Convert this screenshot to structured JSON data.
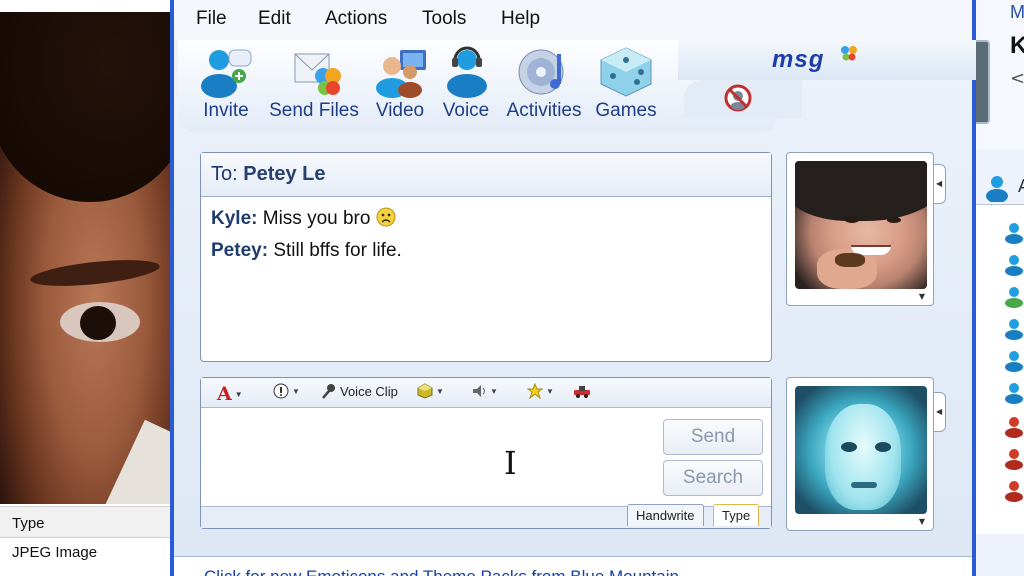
{
  "left_window": {
    "type_header": "Type",
    "type_value": "JPEG Image"
  },
  "menu": {
    "items": [
      "File",
      "Edit",
      "Actions",
      "Tools",
      "Help"
    ]
  },
  "toolbar": {
    "buttons": [
      {
        "label": "Invite",
        "icon": "invite-icon"
      },
      {
        "label": "Send Files",
        "icon": "send-files-icon"
      },
      {
        "label": "Video",
        "icon": "video-icon"
      },
      {
        "label": "Voice",
        "icon": "voice-icon"
      },
      {
        "label": "Activities",
        "icon": "activities-icon"
      },
      {
        "label": "Games",
        "icon": "games-icon"
      }
    ],
    "brand": "msg",
    "block_icon": "block-icon"
  },
  "conversation": {
    "to_prefix": "To:",
    "to_name": "Petey Le",
    "messages": [
      {
        "sender": "Kyle:",
        "text": "Miss you bro",
        "emoticon": "sad-face-icon"
      },
      {
        "sender": "Petey:",
        "text": "Still bffs for life."
      }
    ]
  },
  "compose": {
    "voice_clip_label": "Voice Clip",
    "send_label": "Send",
    "search_label": "Search",
    "mode_tabs": [
      "Handwrite",
      "Type"
    ],
    "active_mode": "Type"
  },
  "ad": {
    "text": "Click for new Emoticons and Theme Packs from Blue Mountain"
  },
  "right_window": {
    "top_letter": "M",
    "name_letter": "K",
    "back_glyph": "<",
    "group_letter": "A"
  },
  "colors": {
    "window_border": "#2a5bd6",
    "label_blue": "#1e3d8a",
    "link_blue": "#1a3fa6"
  }
}
